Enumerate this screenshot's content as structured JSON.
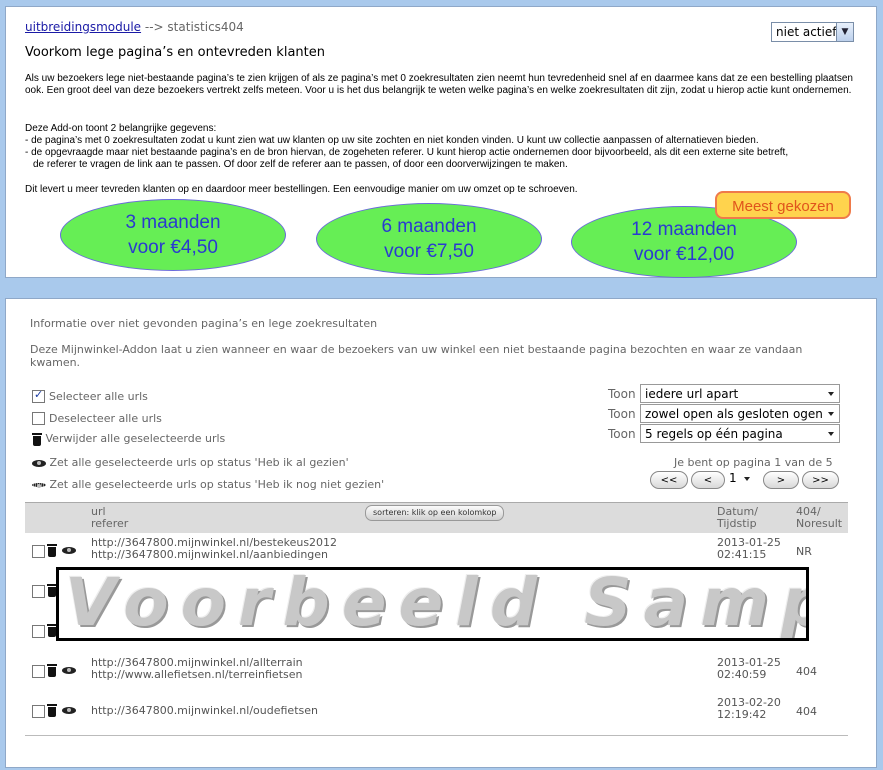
{
  "top": {
    "breadcrumb_link": "uitbreidingsmodule",
    "breadcrumb_sep": "-->",
    "breadcrumb_current": "statistics404",
    "status_value": "niet actief",
    "heading": "Voorkom lege pagina’s en ontevreden klanten",
    "para1": "Als uw bezoekers lege niet-bestaande pagina’s te zien krijgen of als ze pagina’s met 0 zoekresultaten zien neemt hun tevredenheid snel af en daarmee kans dat ze een bestelling plaatsen ook. Een groot deel van deze bezoekers vertrekt zelfs meteen. Voor u is het dus belangrijk te weten welke pagina’s en welke zoekresultaten dit zijn, zodat u hierop actie kunt ondernemen.",
    "para2_intro": "Deze Add-on toont 2 belangrijke gegevens:",
    "para2_item1": "- de pagina’s met 0 zoekresultaten zodat u kunt zien wat uw klanten op uw site zochten en niet konden vinden. U kunt uw collectie aanpassen of alternatieven bieden.",
    "para2_item2a": "- de opgevraagde maar niet bestaande pagina’s en de bron hiervan, de zogeheten referer. U kunt hierop actie ondernemen door bijvoorbeeld, als dit een externe site betreft,",
    "para2_item2b": "de referer te vragen de link aan te passen. Of door zelf de referer aan te passen, of door een doorverwijzingen te maken.",
    "para3": "Dit levert u meer tevreden klanten op en daardoor meer bestellingen. Een eenvoudige manier om uw omzet op te schroeven.",
    "plans": [
      {
        "line1": "3 maanden",
        "line2": "voor €4,50"
      },
      {
        "line1": "6 maanden",
        "line2": "voor €7,50"
      },
      {
        "line1": "12 maanden",
        "line2": "voor €12,00"
      }
    ],
    "badge": "Meest gekozen"
  },
  "bottom": {
    "title": "Informatie over niet gevonden pagina’s en lege zoekresultaten",
    "description": "Deze Mijnwinkel-Addon laat u zien wanneer en waar de bezoekers van uw winkel een niet bestaande pagina bezochten en waar ze vandaan kwamen.",
    "actions": {
      "select_all": "Selecteer alle urls",
      "deselect_all": "Deselecteer alle urls",
      "delete_selected": "Verwijder alle geselecteerde urls",
      "mark_seen": "Zet alle geselecteerde urls op status 'Heb ik al gezien'",
      "mark_unseen": "Zet alle geselecteerde urls op status 'Heb ik nog niet gezien'"
    },
    "filters": [
      {
        "label": "Toon",
        "value": "iedere url apart"
      },
      {
        "label": "Toon",
        "value": "zowel open als gesloten ogen"
      },
      {
        "label": "Toon",
        "value": "5 regels op één pagina"
      }
    ],
    "pagination": {
      "info": "Je bent op pagina 1 van de 5",
      "first": "<<",
      "prev": "<",
      "page": "1",
      "next": ">",
      "last": ">>"
    },
    "table": {
      "col_url": "url",
      "col_referer": "referer",
      "sort_hint": "sorteren: klik op een kolomkop",
      "col_date": "Datum/",
      "col_time": "Tijdstip",
      "col_result": "404/",
      "col_result2": "Noresult",
      "rows": [
        {
          "url": "http://3647800.mijnwinkel.nl/bestekeus2012",
          "referer": "http://3647800.mijnwinkel.nl/aanbiedingen",
          "date": "2013-01-25",
          "time": "02:41:15",
          "result": "NR"
        },
        {
          "url": "",
          "referer": "",
          "date": "",
          "time": "",
          "result": ""
        },
        {
          "url": "",
          "referer": "",
          "date": "",
          "time": "",
          "result": ""
        },
        {
          "url": "http://3647800.mijnwinkel.nl/allterrain",
          "referer": "http://www.allefietsen.nl/terreinfietsen",
          "date": "2013-01-25",
          "time": "02:40:59",
          "result": "404"
        },
        {
          "url": "http://3647800.mijnwinkel.nl/oudefietsen",
          "referer": "",
          "date": "2013-02-20",
          "time": "12:19:42",
          "result": "404"
        }
      ]
    },
    "watermark": "Voorbeeld Sample"
  }
}
